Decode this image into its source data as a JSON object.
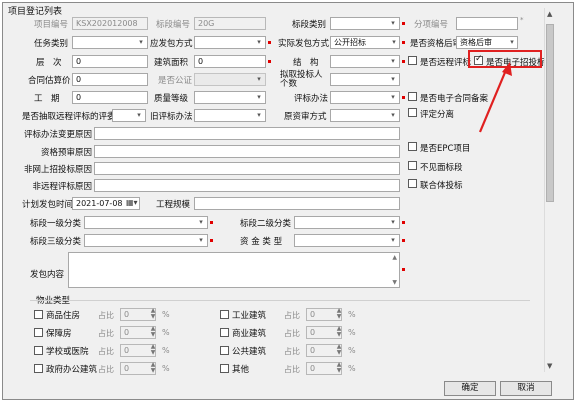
{
  "window_title": "项目登记列表",
  "fields": {
    "project_no_label": "项目编号",
    "project_no": "KSX202012008",
    "bid_section_no_label": "标段编号",
    "bid_section_no": "20G",
    "bid_type_label": "标段类别",
    "sub_item_no_label": "分项编号",
    "task_type_label": "任务类别",
    "contract_mode_label": "应发包方式",
    "actual_contract_mode_label": "实际发包方式",
    "actual_contract_mode": "公开招标",
    "qual_review_label": "是否资格后审",
    "qual_review": "资格后审",
    "floors_label": "层　次",
    "floors": "0",
    "build_area_label": "建筑面积",
    "build_area": "0",
    "structure_label": "结　构",
    "remote_eval_label": "是否远程评标",
    "electronic_bid_label": "是否电子招投标",
    "contract_price_label": "合同估算价",
    "contract_price": "0",
    "is_reserved_label": "是否公证",
    "intended_bidder_label": "拟取投标人个数",
    "duration_label": "工　期",
    "duration": "0",
    "quality_label": "质量等级",
    "eval_method_label": "评标办法",
    "electronic_contract_label": "是否电子合同备案",
    "remote_draw_label": "是否抽取远程评标的评委",
    "old_eval_method_label": "旧评标办法",
    "original_capital_label": "原资审方式",
    "separate_eval_label": "评定分离",
    "eval_change_reason_label": "评标办法变更原因",
    "qual_review_reason_label": "资格预审原因",
    "non_online_reason_label": "非网上招投标原因",
    "non_remote_reason_label": "非远程评标原因",
    "epc_label": "是否EPC项目",
    "no_face_label": "不见面标段",
    "joint_body_label": "联合体投标",
    "plan_date_label": "计划发包时间",
    "plan_date": "2021-07-08",
    "project_scale_label": "工程规模",
    "bid_cat1_label": "标段一级分类",
    "bid_cat2_label": "标段二级分类",
    "bid_cat3_label": "标段三级分类",
    "capital_type_label": "资 金 类 型",
    "contract_content_label": "发包内容"
  },
  "property_group": {
    "title": "物业类型",
    "ratio_label": "占比",
    "percent": "%",
    "items_left": [
      {
        "label": "商品住房",
        "value": "0"
      },
      {
        "label": "保障房",
        "value": "0"
      },
      {
        "label": "学校或医院",
        "value": "0"
      },
      {
        "label": "政府办公建筑",
        "value": "0"
      }
    ],
    "items_right": [
      {
        "label": "工业建筑",
        "value": "0"
      },
      {
        "label": "商业建筑",
        "value": "0"
      },
      {
        "label": "公共建筑",
        "value": "0"
      },
      {
        "label": "其他",
        "value": "0"
      }
    ]
  },
  "buttons": {
    "ok": "确定",
    "cancel": "取消"
  },
  "colors": {
    "required": "#e00000",
    "highlight_box": "#e02020",
    "arrow": "#e02020"
  }
}
